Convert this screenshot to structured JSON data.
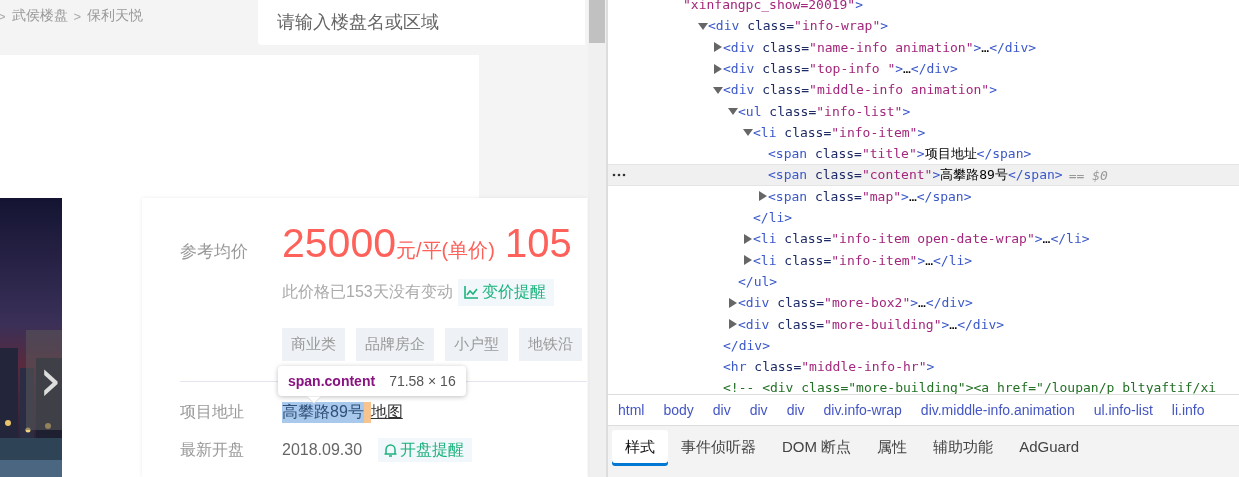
{
  "page": {
    "breadcrumb": [
      {
        "kind": "sep",
        "text": ">"
      },
      {
        "kind": "link",
        "text": "武侯楼盘"
      },
      {
        "kind": "sep",
        "text": ">"
      },
      {
        "kind": "link",
        "text": "保利天悦"
      }
    ],
    "search": {
      "placeholder": "请输入楼盘名或区域"
    },
    "gallery": {
      "kind": "picture",
      "next": "›"
    },
    "price": {
      "label": "参考均价",
      "value": "25000",
      "unit": "元/平(单价)",
      "total": "105",
      "note": "此价格已153天没有变动",
      "alert": "变价提醒"
    },
    "tags": [
      "商业类",
      "品牌房企",
      "小户型",
      "地铁沿"
    ],
    "info": [
      {
        "title": "项目地址",
        "content": "高攀路89号",
        "highlighted": true,
        "action": {
          "kind": "link",
          "text": "地图"
        }
      },
      {
        "title": "最新开盘",
        "content": "2018.09.30",
        "highlighted": false,
        "action": {
          "kind": "button",
          "text": "开盘提醒"
        }
      }
    ],
    "tooltip": {
      "selector": "span.content",
      "size": "71.58 × 16"
    }
  },
  "devtools": {
    "continuation": "\"xinfangpc_show=20019\">",
    "tree": [
      {
        "markup": "<div class=\"info-wrap\">",
        "expanded": true,
        "selected": false,
        "children": [
          {
            "markup": "<div class=\"name-info animation\">…</div>",
            "expanded": false,
            "selected": false
          },
          {
            "markup": "<div class=\"top-info \">…</div>",
            "expanded": false,
            "selected": false
          },
          {
            "markup": "<div class=\"middle-info animation\">",
            "expanded": true,
            "selected": false,
            "close": "</div>",
            "children": [
              {
                "markup": "<ul class=\"info-list\">",
                "expanded": true,
                "selected": false,
                "close": "</ul>",
                "children": [
                  {
                    "markup": "<li class=\"info-item\">",
                    "expanded": true,
                    "selected": false,
                    "close": "</li>",
                    "children": [
                      {
                        "markup": "<span class=\"title\">项目地址</span>",
                        "selected": false
                      },
                      {
                        "markup": "<span class=\"content\">高攀路89号</span>",
                        "selected": true,
                        "console_ref": "== $0"
                      },
                      {
                        "markup": "<span class=\"map\">…</span>",
                        "expanded": false,
                        "selected": false
                      }
                    ]
                  },
                  {
                    "markup": "<li class=\"info-item open-date-wrap\">…</li>",
                    "expanded": false,
                    "selected": false
                  },
                  {
                    "markup": "<li class=\"info-item\">…</li>",
                    "expanded": false,
                    "selected": false
                  }
                ]
              },
              {
                "markup": "<div class=\"more-box2\">…</div>",
                "expanded": false,
                "selected": false
              },
              {
                "markup": "<div class=\"more-building\">…</div>",
                "expanded": false,
                "selected": false
              }
            ]
          },
          {
            "markup": "<hr class=\"middle-info-hr\">",
            "selected": false
          },
          {
            "kind": "comment",
            "markup": "<!-- <div class=\"more-building\"><a href=\"/loupan/p_bltyaftif/xi",
            "selected": false
          }
        ]
      }
    ],
    "crumbs": [
      "html",
      "body",
      "div",
      "div",
      "div",
      "div.info-wrap",
      "div.middle-info.animation",
      "ul.info-list",
      "li.info"
    ],
    "tabs": [
      {
        "label": "样式",
        "selected": true
      },
      {
        "label": "事件侦听器",
        "selected": false
      },
      {
        "label": "DOM 断点",
        "selected": false
      },
      {
        "label": "属性",
        "selected": false
      },
      {
        "label": "辅助功能",
        "selected": false
      },
      {
        "label": "AdGuard",
        "selected": false
      }
    ]
  }
}
